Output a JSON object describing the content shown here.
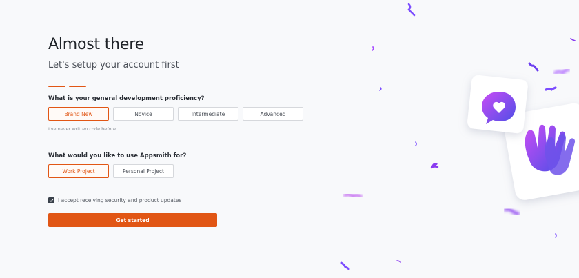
{
  "heading": {
    "title": "Almost there",
    "subtitle": "Let's setup your account first"
  },
  "proficiency": {
    "question": "What is your general development proficiency?",
    "options": [
      "Brand New",
      "Novice",
      "Intermediate",
      "Advanced"
    ],
    "selected": "Brand New",
    "hint": "I've never written code before."
  },
  "usage": {
    "question": "What would you like to use Appsmith for?",
    "options": [
      "Work Project",
      "Personal Project"
    ],
    "selected": "Work Project"
  },
  "consent": {
    "label": "I accept receiving security and product updates",
    "checked": true
  },
  "cta": {
    "label": "Get started"
  },
  "colors": {
    "accent": "#e15615",
    "confetti": "#7c4dff"
  },
  "icons": [
    "heart-chat-icon",
    "waving-hands-icon",
    "confetti-icon"
  ]
}
